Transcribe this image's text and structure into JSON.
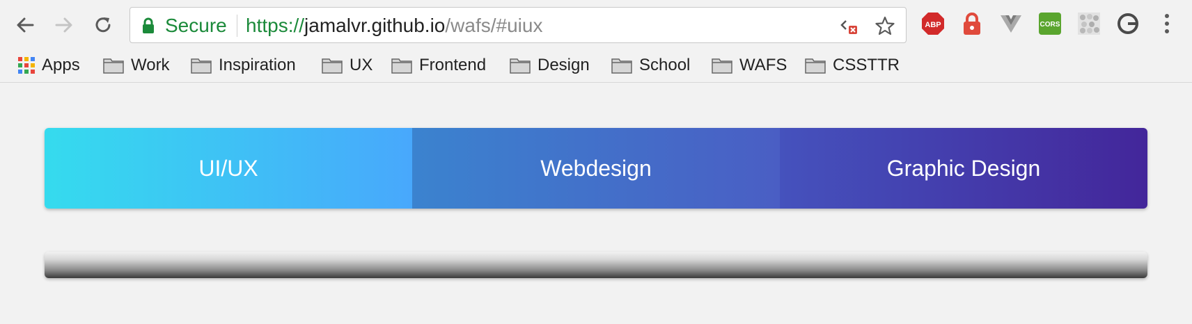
{
  "browser": {
    "security_label": "Secure",
    "url": {
      "scheme": "https://",
      "host": "jamalvr.github.io",
      "path": "/wafs/#uiux"
    },
    "extensions": [
      {
        "name": "adblock-plus-icon",
        "label": "ABP",
        "color": "#d22a2a"
      },
      {
        "name": "lock-extension-icon",
        "color": "#e04a3c"
      },
      {
        "name": "vue-devtools-icon",
        "color": "#9a9a9a"
      },
      {
        "name": "cors-extension-icon",
        "label": "CORS",
        "color": "#5aa52e"
      },
      {
        "name": "pattern-extension-icon",
        "color": "#bdbdbd"
      },
      {
        "name": "circle-extension-icon",
        "color": "#4a4a4a"
      }
    ]
  },
  "bookmarks": [
    {
      "label": "Apps",
      "icon": "apps-grid-icon"
    },
    {
      "label": "Work",
      "icon": "folder-icon"
    },
    {
      "label": "Inspiration",
      "icon": "folder-icon"
    },
    {
      "label": "UX",
      "icon": "folder-icon"
    },
    {
      "label": "Frontend",
      "icon": "folder-icon"
    },
    {
      "label": "Design",
      "icon": "folder-icon"
    },
    {
      "label": "School",
      "icon": "folder-icon"
    },
    {
      "label": "WAFS",
      "icon": "folder-icon"
    },
    {
      "label": "CSSTTR",
      "icon": "folder-icon"
    }
  ],
  "tabs": [
    {
      "label": "UI/UX",
      "active": true
    },
    {
      "label": "Webdesign",
      "active": false
    },
    {
      "label": "Graphic Design",
      "active": false
    }
  ]
}
